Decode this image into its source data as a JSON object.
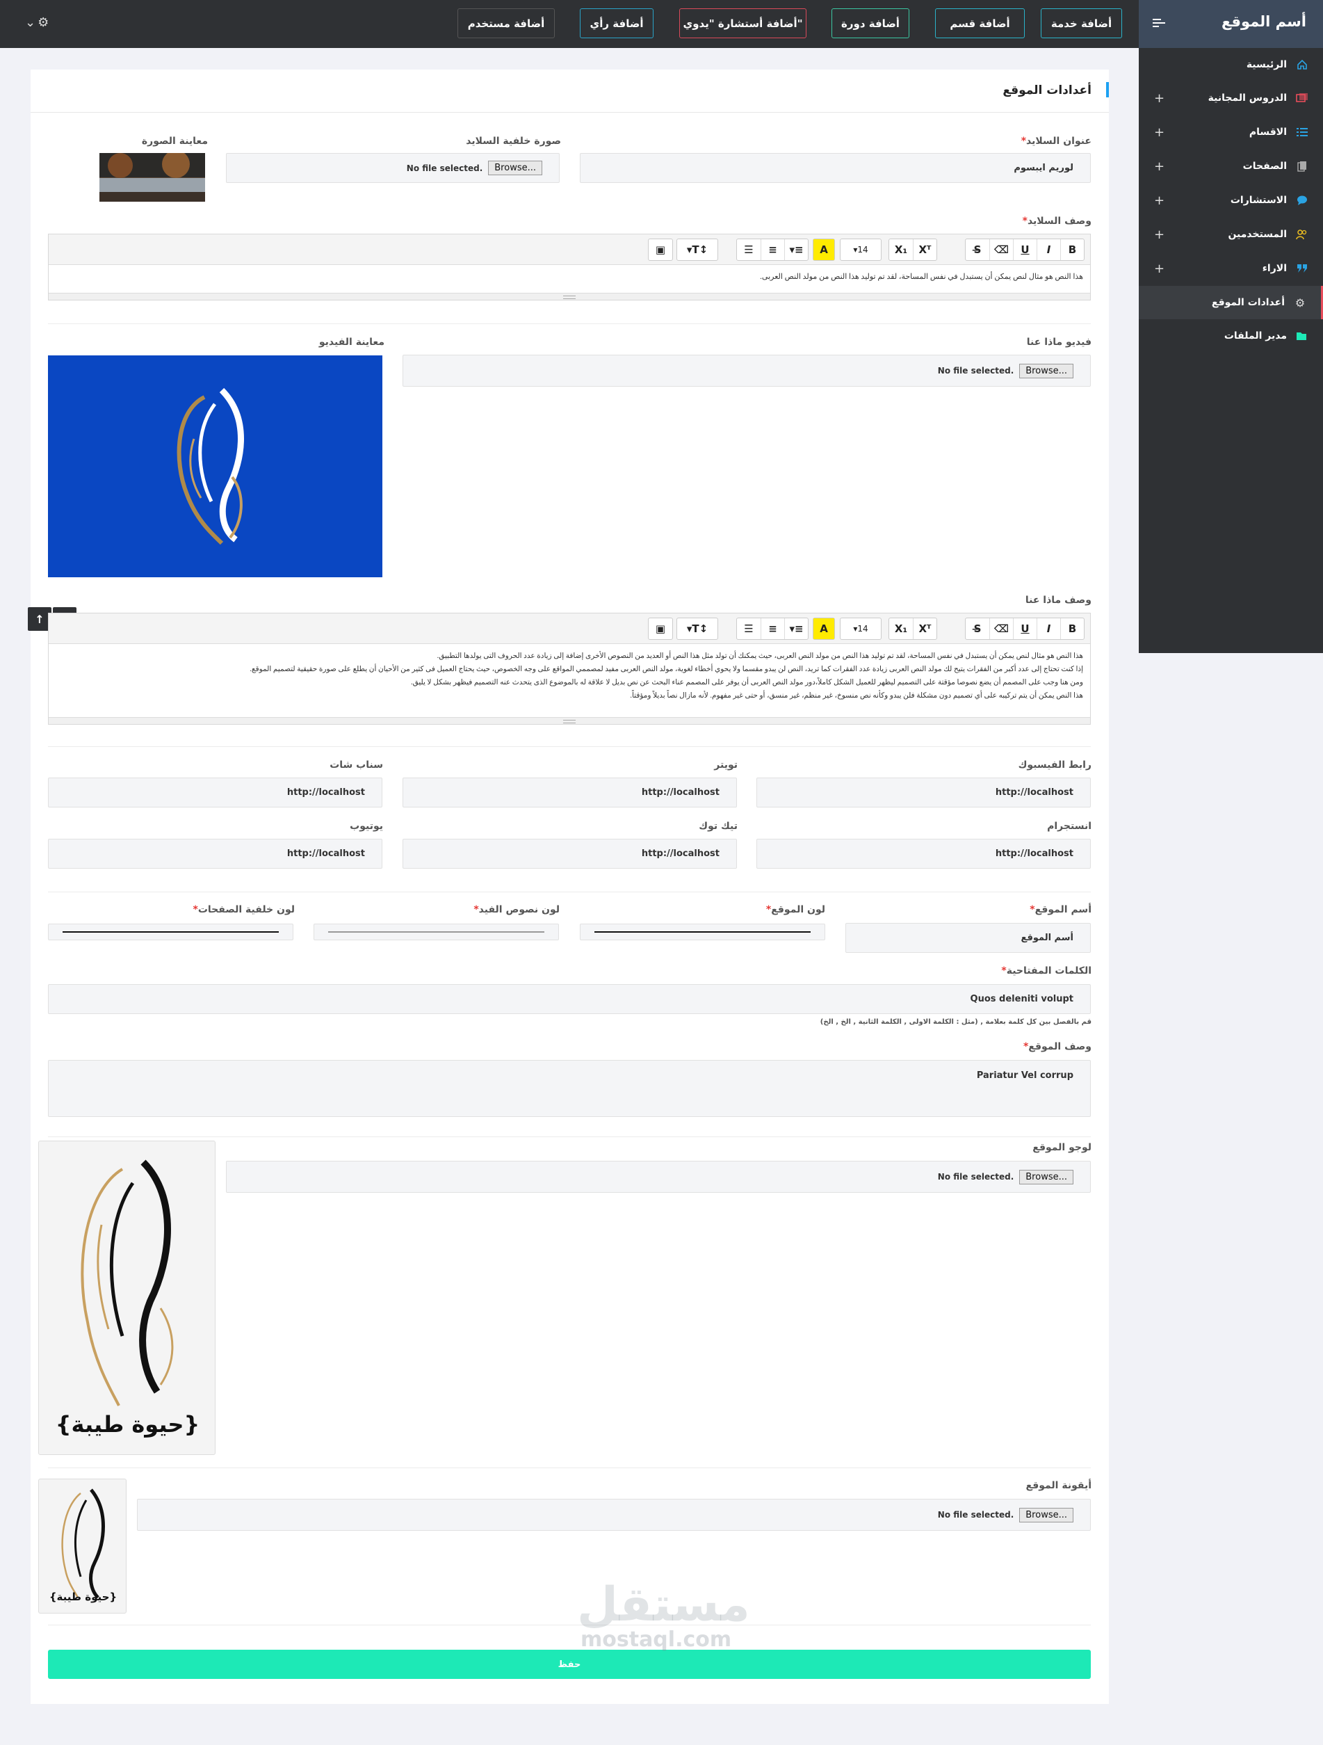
{
  "brand": {
    "title": "أسم الموقع"
  },
  "topbar": {
    "buttons": [
      "أضافة خدمة",
      "أضافة قسم",
      "أضافة دورة",
      "أضافة أستشارة \"يدوي\"",
      "أضافة رأي",
      "أضافة مستخدم"
    ]
  },
  "sidebar": {
    "items": [
      {
        "label": "الرئيسية",
        "icon": "home-icon"
      },
      {
        "label": "الدروس المجانية",
        "icon": "video-icon",
        "expandable": true
      },
      {
        "label": "الاقسام",
        "icon": "list-icon",
        "expandable": true
      },
      {
        "label": "الصفحات",
        "icon": "pages-icon",
        "expandable": true
      },
      {
        "label": "الاستشارات",
        "icon": "chat-icon",
        "expandable": true
      },
      {
        "label": "المستخدمين",
        "icon": "users-icon",
        "expandable": true
      },
      {
        "label": "الاراء",
        "icon": "quote-icon",
        "expandable": true
      },
      {
        "label": "أعدادات الموقع",
        "icon": "gear-icon",
        "active": true
      },
      {
        "label": "مدير الملفات",
        "icon": "folder-icon"
      }
    ],
    "plus": "+"
  },
  "page": {
    "title": "أعدادات الموقع"
  },
  "slider": {
    "title_label": "عنوان السلايد",
    "title_value": "لوريم ايبسوم",
    "bg_label": "صورة خلفية السلايد",
    "preview_label": "معاينة الصورة",
    "desc_label": "وصف السلايد",
    "desc_text": "هذا النص هو مثال لنص يمكن أن يستبدل في نفس المساحة، لقد تم توليد هذا النص من مولد النص العربى."
  },
  "file": {
    "browse": "Browse...",
    "nofile": "No file selected."
  },
  "about": {
    "video_label": "فيديو ماذا عنا",
    "preview_label": "معاينة الفيديو",
    "desc_label": "وصف ماذا عنا",
    "desc_lines": [
      "هذا النص هو مثال لنص يمكن أن يستبدل في نفس المساحة، لقد تم توليد هذا النص من مولد النص العربى، حيث يمكنك أن تولد مثل هذا النص أو العديد من النصوص الأخرى إضافة إلى زيادة عدد الحروف التى يولدها التطبيق.",
      "إذا كنت تحتاج إلى عدد أكبر من الفقرات يتيح لك مولد النص العربى زيادة عدد الفقرات كما تريد، النص لن يبدو مقسما ولا يحوي أخطاء لغوية، مولد النص العربى مفيد لمصممي المواقع على وجه الخصوص، حيث يحتاج العميل فى كثير من الأحيان أن يطلع على صورة حقيقية لتصميم الموقع.",
      "ومن هنا وجب على المصمم أن يضع نصوصا مؤقتة على التصميم ليظهر للعميل الشكل كاملاً،دور مولد النص العربى أن يوفر على المصمم عناء البحث عن نص بديل لا علاقة له بالموضوع الذى يتحدث عنه التصميم فيظهر بشكل لا يليق.",
      "هذا النص يمكن أن يتم تركيبه على أي تصميم دون مشكلة فلن يبدو وكأنه نص منسوخ، غير منظم، غير منسق، أو حتى غير مفهوم. لأنه مازال نصاً بديلاً ومؤقتاً."
    ]
  },
  "editor": {
    "font_size": "14"
  },
  "social": {
    "facebook_label": "رابط الفيسبوك",
    "facebook_value": "http://localhost",
    "twitter_label": "تويتر",
    "twitter_value": "http://localhost",
    "snapchat_label": "سناب شات",
    "snapchat_value": "http://localhost",
    "instagram_label": "انستجرام",
    "instagram_value": "http://localhost",
    "tiktok_label": "تيك توك",
    "tiktok_value": "http://localhost",
    "youtube_label": "يوتيوب",
    "youtube_value": "http://localhost"
  },
  "site": {
    "name_label": "أسم الموقع",
    "name_value": "أسم الموقع",
    "color_label": "لون الموقع",
    "color_value": "#000000",
    "footer_color_label": "لون نصوص الفيد",
    "footer_color_value": "#888888",
    "page_bg_label": "لون خلفية الصفحات",
    "page_bg_value": "#000000",
    "keywords_label": "الكلمات المفتاحية",
    "keywords_value": "Quos deleniti volupt",
    "keywords_hint": "قم بالفصل بين كل كلمة بعلامة , (مثل : الكلمة الاولى , الكلمة الثانية , الخ , الخ)",
    "desc_label": "وصف الموقع",
    "desc_value": "Pariatur Vel corrup",
    "logo_label": "لوجو الموقع",
    "icon_label": "أيقونة الموقع",
    "logo_text": "{حيوة طيبة}"
  },
  "actions": {
    "save": "حفظ"
  },
  "watermark": {
    "ar": "مستقل",
    "en": "mostaql.com"
  },
  "colors": {
    "accent": "#1de9b6",
    "sidebar": "#2f3134",
    "video_bg": "#0a47c2"
  }
}
